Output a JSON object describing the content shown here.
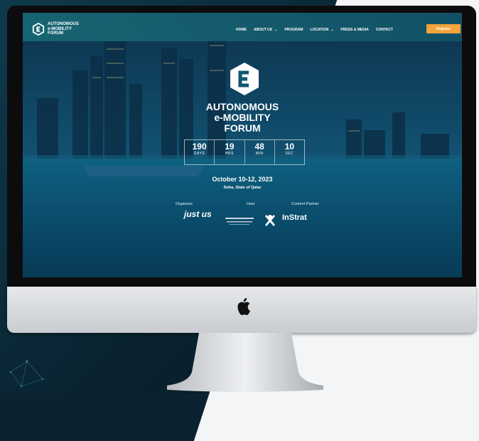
{
  "nav": {
    "logo_text": "AUTONOMOUS\ne-MOBILITY\nFORUM",
    "items": [
      {
        "label": "HOME",
        "has_dropdown": false
      },
      {
        "label": "ABOUT US",
        "has_dropdown": true
      },
      {
        "label": "PROGRAM",
        "has_dropdown": false
      },
      {
        "label": "LOCATION",
        "has_dropdown": true
      },
      {
        "label": "PRESS & MEDIA",
        "has_dropdown": false
      },
      {
        "label": "CONTACT",
        "has_dropdown": false
      }
    ],
    "register_label": "Register"
  },
  "hero": {
    "title_line1": "AUTONOMOUS",
    "title_line2": "e-MOBILITY",
    "title_line3": "FORUM",
    "countdown": [
      {
        "value": "190",
        "unit": "DAYS"
      },
      {
        "value": "19",
        "unit": "HRS"
      },
      {
        "value": "48",
        "unit": "MIN"
      },
      {
        "value": "10",
        "unit": "SEC"
      }
    ],
    "date": "October 10-12, 2023",
    "location": "Doha, State of Qatar"
  },
  "partners": {
    "organizer_label": "Organizer",
    "host_label": "Host",
    "content_partner_label": "Content Partner",
    "organizer_logo_text": "just us",
    "content_partner_logo_text": "InStrat"
  },
  "colors": {
    "accent": "#f4a43a",
    "nav_bg": "#186c78",
    "screen_water": "#0c6d8a"
  }
}
